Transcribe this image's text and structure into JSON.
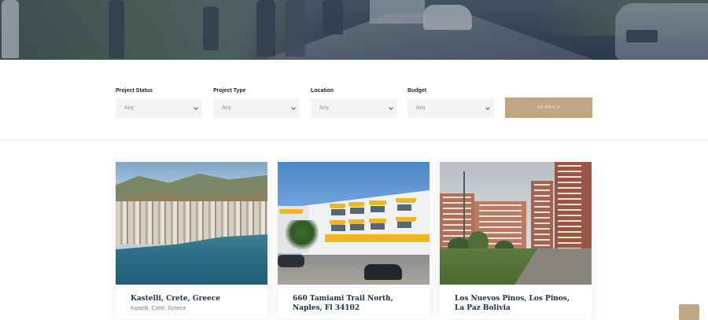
{
  "search": {
    "fields": [
      {
        "label": "Project Status",
        "value": "Any"
      },
      {
        "label": "Project Type",
        "value": "Any"
      },
      {
        "label": "Location",
        "value": "Any"
      },
      {
        "label": "Budget",
        "value": "Any"
      }
    ],
    "button_label": "SEARCH"
  },
  "cards": [
    {
      "title": "Kastelli, Crete, Greece",
      "subtitle": "Kastelli, Crete, Greece",
      "image": "coastal-town-photo"
    },
    {
      "title": "660 Tamiami Trail North, Naples, Fl 34102",
      "subtitle": "",
      "image": "building-yellow-awnings-photo"
    },
    {
      "title": "Los Nuevos Pinos, Los Pinos, La Paz Bolivia",
      "subtitle": "",
      "image": "apartment-blocks-photo"
    }
  ],
  "colors": {
    "accent": "#c0a783",
    "title": "#1c2f4a",
    "field_bg": "#f4f4f4"
  },
  "icons": {
    "select_arrow": "chevron-down-icon",
    "back_to_top": "arrow-up-icon"
  }
}
